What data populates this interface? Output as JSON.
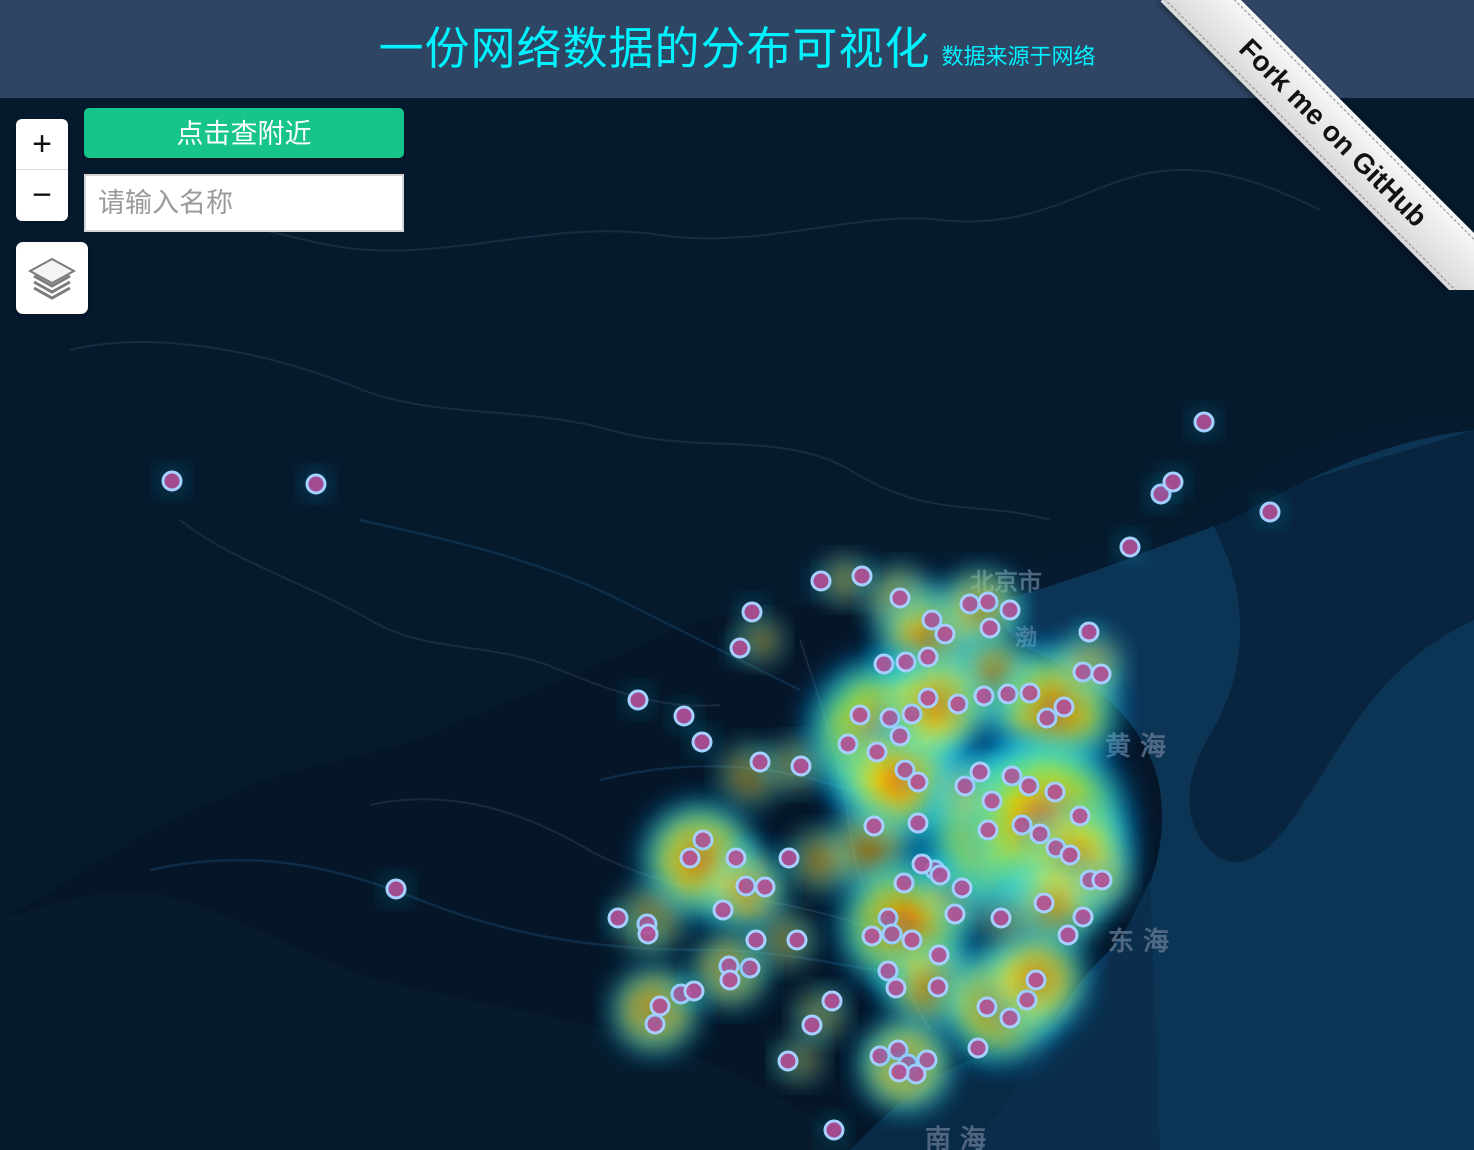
{
  "header": {
    "title": "一份网络数据的分布可视化",
    "subtitle": "数据来源于网络"
  },
  "controls": {
    "zoom_in_label": "+",
    "zoom_out_label": "−",
    "nearby_button_label": "点击查附近",
    "search_placeholder": "请输入名称",
    "layers_icon": "layers-icon"
  },
  "ribbon": {
    "text": "Fork me on GitHub"
  },
  "map": {
    "labels": {
      "beijing": "北京市",
      "bohai": "渤",
      "yellow_sea": "黄 海",
      "east_sea": "东 海",
      "south_sea": "南 海"
    },
    "colors": {
      "background": "#051628",
      "land": "#071b2d",
      "sea": "#0c3656",
      "marker_fill": "#b44f97",
      "marker_stroke": "#a7cfff"
    }
  }
}
